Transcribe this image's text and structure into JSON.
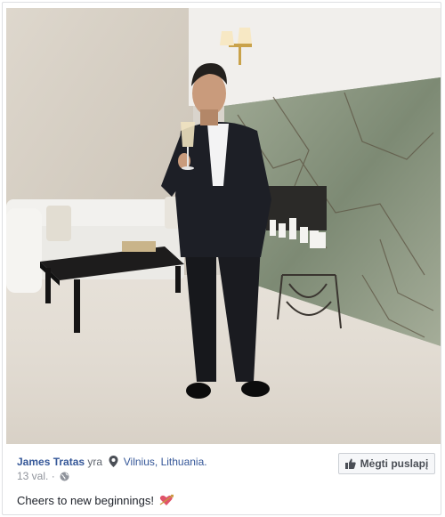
{
  "post": {
    "author_name": "James Tratas",
    "author_verb": "yra",
    "location": "Vilnius, Lithuania.",
    "time": "13 val.",
    "separator": "·",
    "like_button_label": "Mėgti puslapį",
    "caption": "Cheers to new beginnings!"
  },
  "icons": {
    "location": "map-pin-icon",
    "audience": "globe-icon",
    "like": "thumbs-up-icon",
    "caption_emoji": "heart-arrow-icon"
  },
  "colors": {
    "link": "#365899",
    "meta": "#90949c",
    "text": "#1d2129",
    "button_bg": "#f6f7f9"
  }
}
